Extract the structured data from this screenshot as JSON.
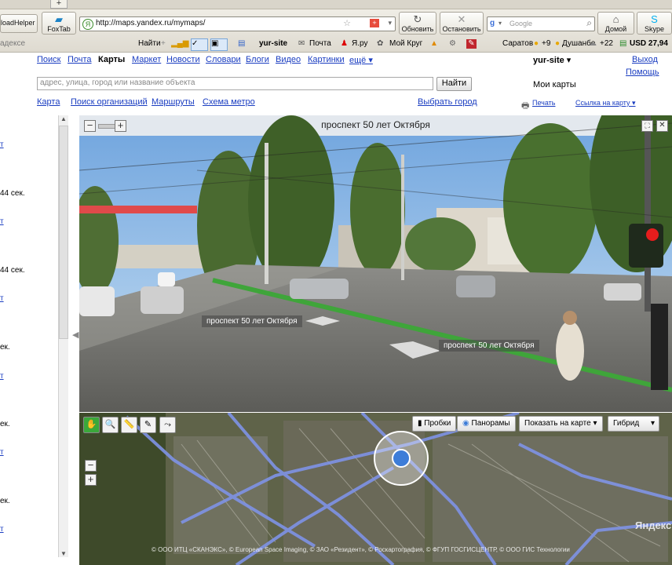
{
  "browser": {
    "tab_left_label": "loadHelper",
    "foxtab_label": "FoxTab",
    "url": "http://maps.yandex.ru/mymaps/",
    "reload_label": "Обновить",
    "stop_label": "Остановить",
    "search_placeholder": "Google",
    "home_label": "Домой",
    "skype_label": "Skype",
    "bar_left_text": "адексе",
    "bar_find": "Найти",
    "bar_site": "yur-site",
    "bar_mail": "Почта",
    "bar_yaru": "Я.ру",
    "bar_moykrug": "Мой Круг",
    "bar_city1": "Саратов",
    "bar_temp1": "+9",
    "bar_city2": "Душанбе",
    "bar_temp2": "+22",
    "bar_usd": "USD 27,94"
  },
  "nav": {
    "items": [
      "Поиск",
      "Почта",
      "Карты",
      "Маркет",
      "Новости",
      "Словари",
      "Блоги",
      "Видео",
      "Картинки",
      "ещё ▾"
    ],
    "user": "yur-site ▾",
    "logout": "Выход",
    "help": "Помощь"
  },
  "search": {
    "placeholder": "адрес, улица, город или название объекта",
    "button": "Найти"
  },
  "subnav": {
    "map": "Карта",
    "orgs": "Поиск организаций",
    "routes": "Маршруты",
    "metro": "Схема метро",
    "city": "Выбрать город",
    "my_maps": "Мои карты",
    "print": "Печать",
    "link": "Ссылка на карту ▾"
  },
  "left_list": {
    "items": [
      "т",
      "44 сек.",
      "т",
      "44 сек.",
      "т",
      "ек.",
      "т",
      "ек.",
      "т",
      "ек.",
      "т"
    ]
  },
  "panorama": {
    "title": "проспект 50 лет Октября",
    "label_left": "проспект 50 лет Октября",
    "label_right": "проспект 50 лет Октября",
    "zoom_out": "−",
    "zoom_in": "+",
    "close": "✕"
  },
  "map": {
    "traffic": "Пробки",
    "panoramas": "Панорамы",
    "show_on_map": "Показать на карте",
    "layer": "Гибрид",
    "zoom_out": "−",
    "zoom_in": "+",
    "copyright": "© ООО ИТЦ «СКАНЭКС», © European Space Imaging, © ЗАО «Резидент», © Роскартография, © ФГУП ГОСГИСЦЕНТР, © ООО ГИС Технологии",
    "logo": "Яндекс"
  },
  "colors": {
    "link": "#1a3dc1",
    "road": "#7f93e6",
    "sky": "#9ec7ec"
  }
}
